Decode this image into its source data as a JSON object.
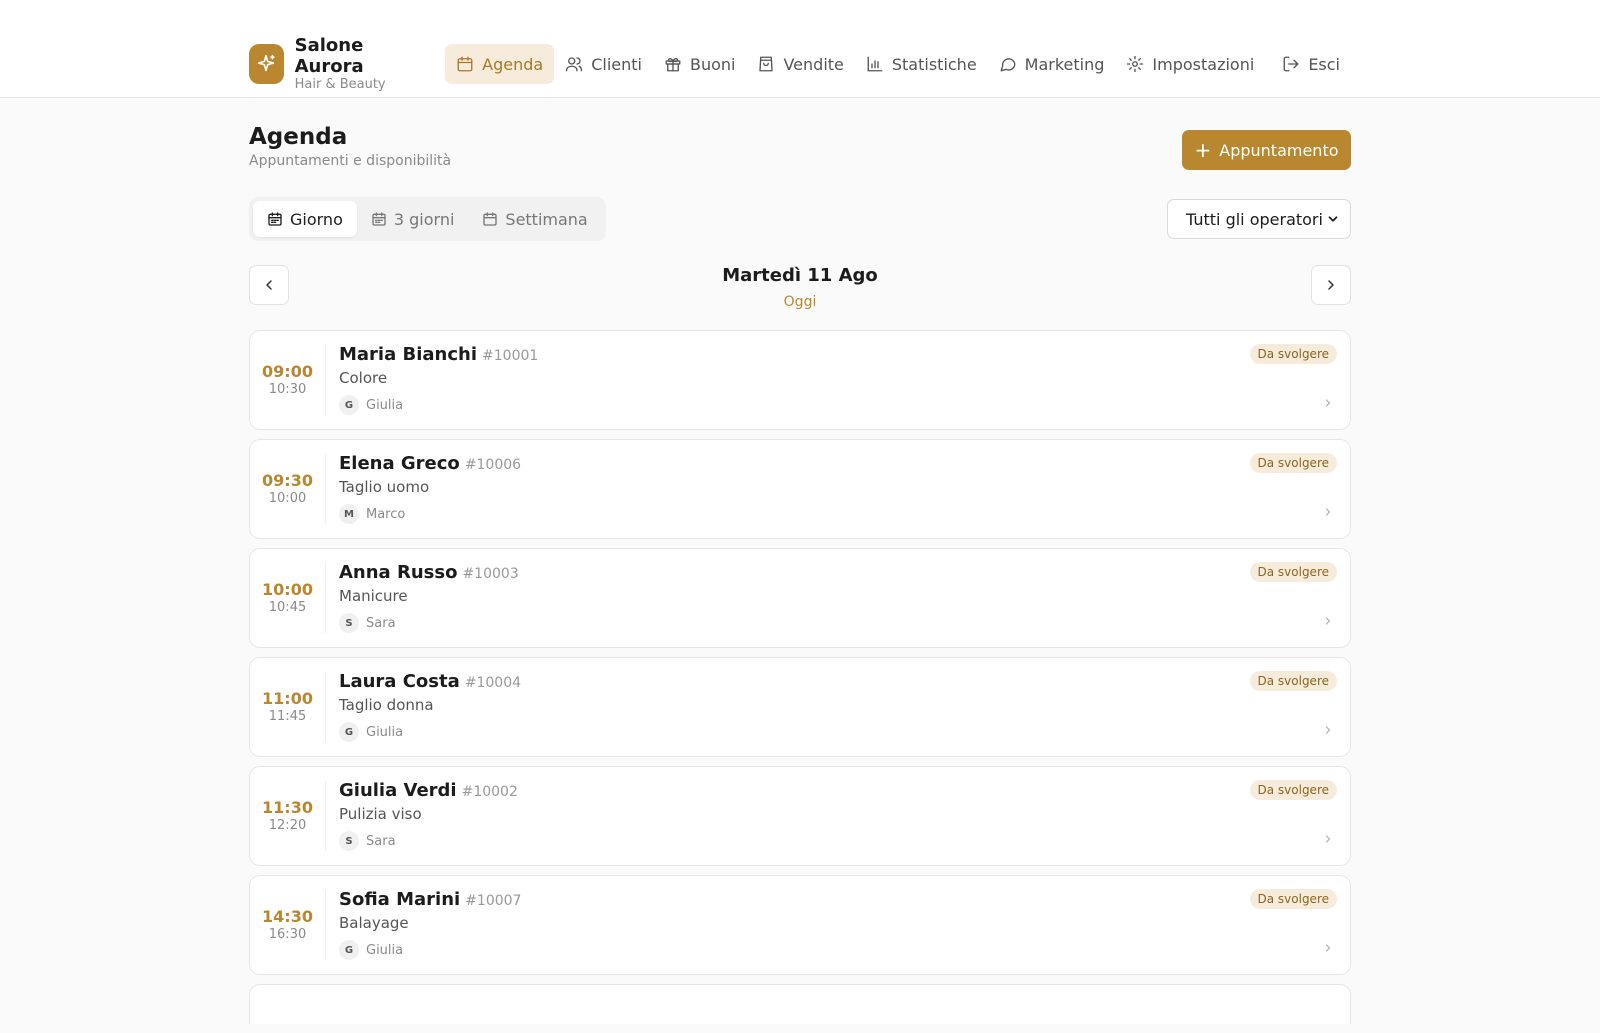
{
  "brand": {
    "name": "Salone Aurora",
    "subtitle": "Hair & Beauty",
    "logo_icon": "sparkles-icon",
    "accent": "#b8872f"
  },
  "nav": {
    "items": [
      {
        "label": "Agenda",
        "icon": "calendar-icon",
        "active": true
      },
      {
        "label": "Clienti",
        "icon": "users-icon"
      },
      {
        "label": "Buoni",
        "icon": "gift-icon"
      },
      {
        "label": "Vendite",
        "icon": "shopping-bag-icon"
      },
      {
        "label": "Statistiche",
        "icon": "bar-chart-icon"
      },
      {
        "label": "Marketing",
        "icon": "message-circle-icon"
      },
      {
        "label": "Impostazioni",
        "icon": "gear-icon"
      }
    ],
    "logout": {
      "label": "Esci",
      "icon": "log-out-icon"
    }
  },
  "page": {
    "title": "Agenda",
    "subtitle": "Appuntamenti e disponibilità",
    "new_button": {
      "plus": "+",
      "label": "Appuntamento"
    }
  },
  "views": {
    "day": "Giorno",
    "three_days": "3 giorni",
    "week": "Settimana",
    "active": "Giorno"
  },
  "operator_filter": {
    "selected": "Tutti gli operatori",
    "options": [
      "Tutti gli operatori"
    ]
  },
  "date_nav": {
    "label": "Martedì 11 Ago",
    "today": "Oggi"
  },
  "appointments": [
    {
      "start": "09:00",
      "end": "10:30",
      "client": "Maria Bianchi",
      "id": "#10001",
      "service": "Colore",
      "operator_initial": "G",
      "operator": "Giulia",
      "status": "Da svolgere"
    },
    {
      "start": "09:30",
      "end": "10:00",
      "client": "Elena Greco",
      "id": "#10006",
      "service": "Taglio uomo",
      "operator_initial": "M",
      "operator": "Marco",
      "status": "Da svolgere"
    },
    {
      "start": "10:00",
      "end": "10:45",
      "client": "Anna Russo",
      "id": "#10003",
      "service": "Manicure",
      "operator_initial": "S",
      "operator": "Sara",
      "status": "Da svolgere"
    },
    {
      "start": "11:00",
      "end": "11:45",
      "client": "Laura Costa",
      "id": "#10004",
      "service": "Taglio donna",
      "operator_initial": "G",
      "operator": "Giulia",
      "status": "Da svolgere"
    },
    {
      "start": "11:30",
      "end": "12:20",
      "client": "Giulia Verdi",
      "id": "#10002",
      "service": "Pulizia viso",
      "operator_initial": "S",
      "operator": "Sara",
      "status": "Da svolgere"
    },
    {
      "start": "14:30",
      "end": "16:30",
      "client": "Sofia Marini",
      "id": "#10007",
      "service": "Balayage",
      "operator_initial": "G",
      "operator": "Giulia",
      "status": "Da svolgere"
    }
  ]
}
